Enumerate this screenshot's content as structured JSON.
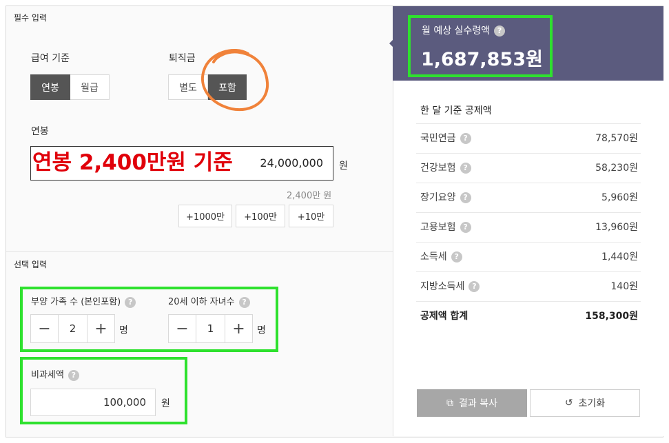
{
  "required": {
    "section_title": "필수 입력",
    "salary_basis": {
      "label": "급여 기준",
      "options": [
        "연봉",
        "월급"
      ],
      "selected": "연봉"
    },
    "severance": {
      "label": "퇴직금",
      "options": [
        "별도",
        "포함"
      ],
      "selected": "포함"
    },
    "annual": {
      "label": "연봉",
      "overlay_text": "연봉 2,400만원 기준",
      "value": "24,000,000",
      "unit": "원",
      "sub_amount": "2,400만 원",
      "quick_buttons": [
        "+1000만",
        "+100만",
        "+10만"
      ]
    }
  },
  "optional": {
    "section_title": "선택 입력",
    "dependents": {
      "label": "부양 가족 수 (본인포함)",
      "value": "2",
      "unit": "명"
    },
    "children": {
      "label": "20세 이하 자녀수",
      "value": "1",
      "unit": "명"
    },
    "taxfree": {
      "label": "비과세액",
      "value": "100,000",
      "unit": "원"
    },
    "minus": "−",
    "plus": "+",
    "help": "?"
  },
  "result": {
    "label": "월 예상 실수령액",
    "value": "1,687,853원",
    "deduction_title": "한 달 기준 공제액",
    "deductions": [
      {
        "name": "국민연금",
        "amount": "78,570원"
      },
      {
        "name": "건강보험",
        "amount": "58,230원"
      },
      {
        "name": "장기요양",
        "amount": "5,960원"
      },
      {
        "name": "고용보험",
        "amount": "13,960원"
      },
      {
        "name": "소득세",
        "amount": "1,440원"
      },
      {
        "name": "지방소득세",
        "amount": "140원"
      }
    ],
    "total": {
      "name": "공제액 합계",
      "amount": "158,300원"
    },
    "copy_label": "결과 복사",
    "reset_label": "초기화"
  },
  "colors": {
    "header_bg": "#5b5b7e",
    "active_option": "#555555",
    "annotation_green": "#2ee12e",
    "annotation_orange": "#f0823a",
    "overlay_red": "#e0000a"
  }
}
